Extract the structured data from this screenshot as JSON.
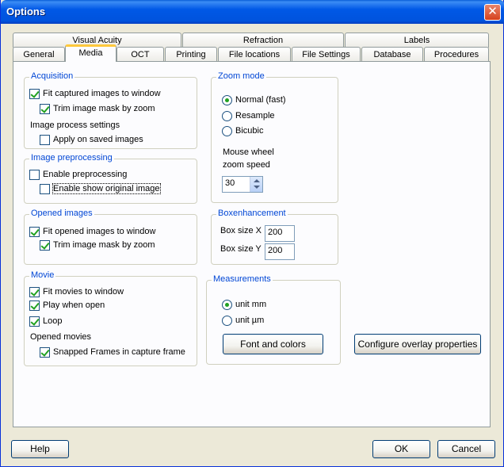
{
  "window": {
    "title": "Options",
    "close_symbol": "✕"
  },
  "tabs_row1": [
    "Visual Acuity",
    "Refraction",
    "Labels"
  ],
  "tabs_row2": [
    "General",
    "Media",
    "OCT",
    "Printing",
    "File locations",
    "File Settings",
    "Database",
    "Procedures"
  ],
  "acquisition": {
    "legend": "Acquisition",
    "fit_captured": "Fit captured images to window",
    "trim_mask": "Trim image mask by zoom",
    "process_settings": "Image process settings",
    "apply_saved": "Apply on saved images"
  },
  "preprocessing": {
    "legend": "Image preprocessing",
    "enable": "Enable preprocessing",
    "show_original": "Enable show original image"
  },
  "opened_images": {
    "legend": "Opened images",
    "fit_opened": "Fit opened images to window",
    "trim_mask": "Trim image mask by zoom"
  },
  "movie": {
    "legend": "Movie",
    "fit_movies": "Fit movies to window",
    "play_open": "Play when open",
    "loop": "Loop",
    "opened_movies": "Opened movies",
    "snapped_frames": "Snapped Frames in capture frame"
  },
  "zoom_mode": {
    "legend": "Zoom mode",
    "normal": "Normal (fast)",
    "resample": "Resample",
    "bicubic": "Bicubic",
    "wheel_label_1": "Mouse wheel",
    "wheel_label_2": "zoom speed",
    "wheel_value": "30"
  },
  "boxenhancement": {
    "legend": "Boxenhancement",
    "size_x_label": "Box size X",
    "size_x_value": "200",
    "size_y_label": "Box size Y",
    "size_y_value": "200"
  },
  "measurements": {
    "legend": "Measurements",
    "unit_mm": "unit mm",
    "unit_um": "unit µm",
    "font_colors": "Font and colors"
  },
  "overlay_button": "Configure overlay properties",
  "footer": {
    "help": "Help",
    "ok": "OK",
    "cancel": "Cancel"
  },
  "colors": {
    "title_bar": "#0058e6",
    "legend_text": "#0046d5",
    "check_green": "#21a121",
    "tab_highlight": "#ffc83c"
  }
}
